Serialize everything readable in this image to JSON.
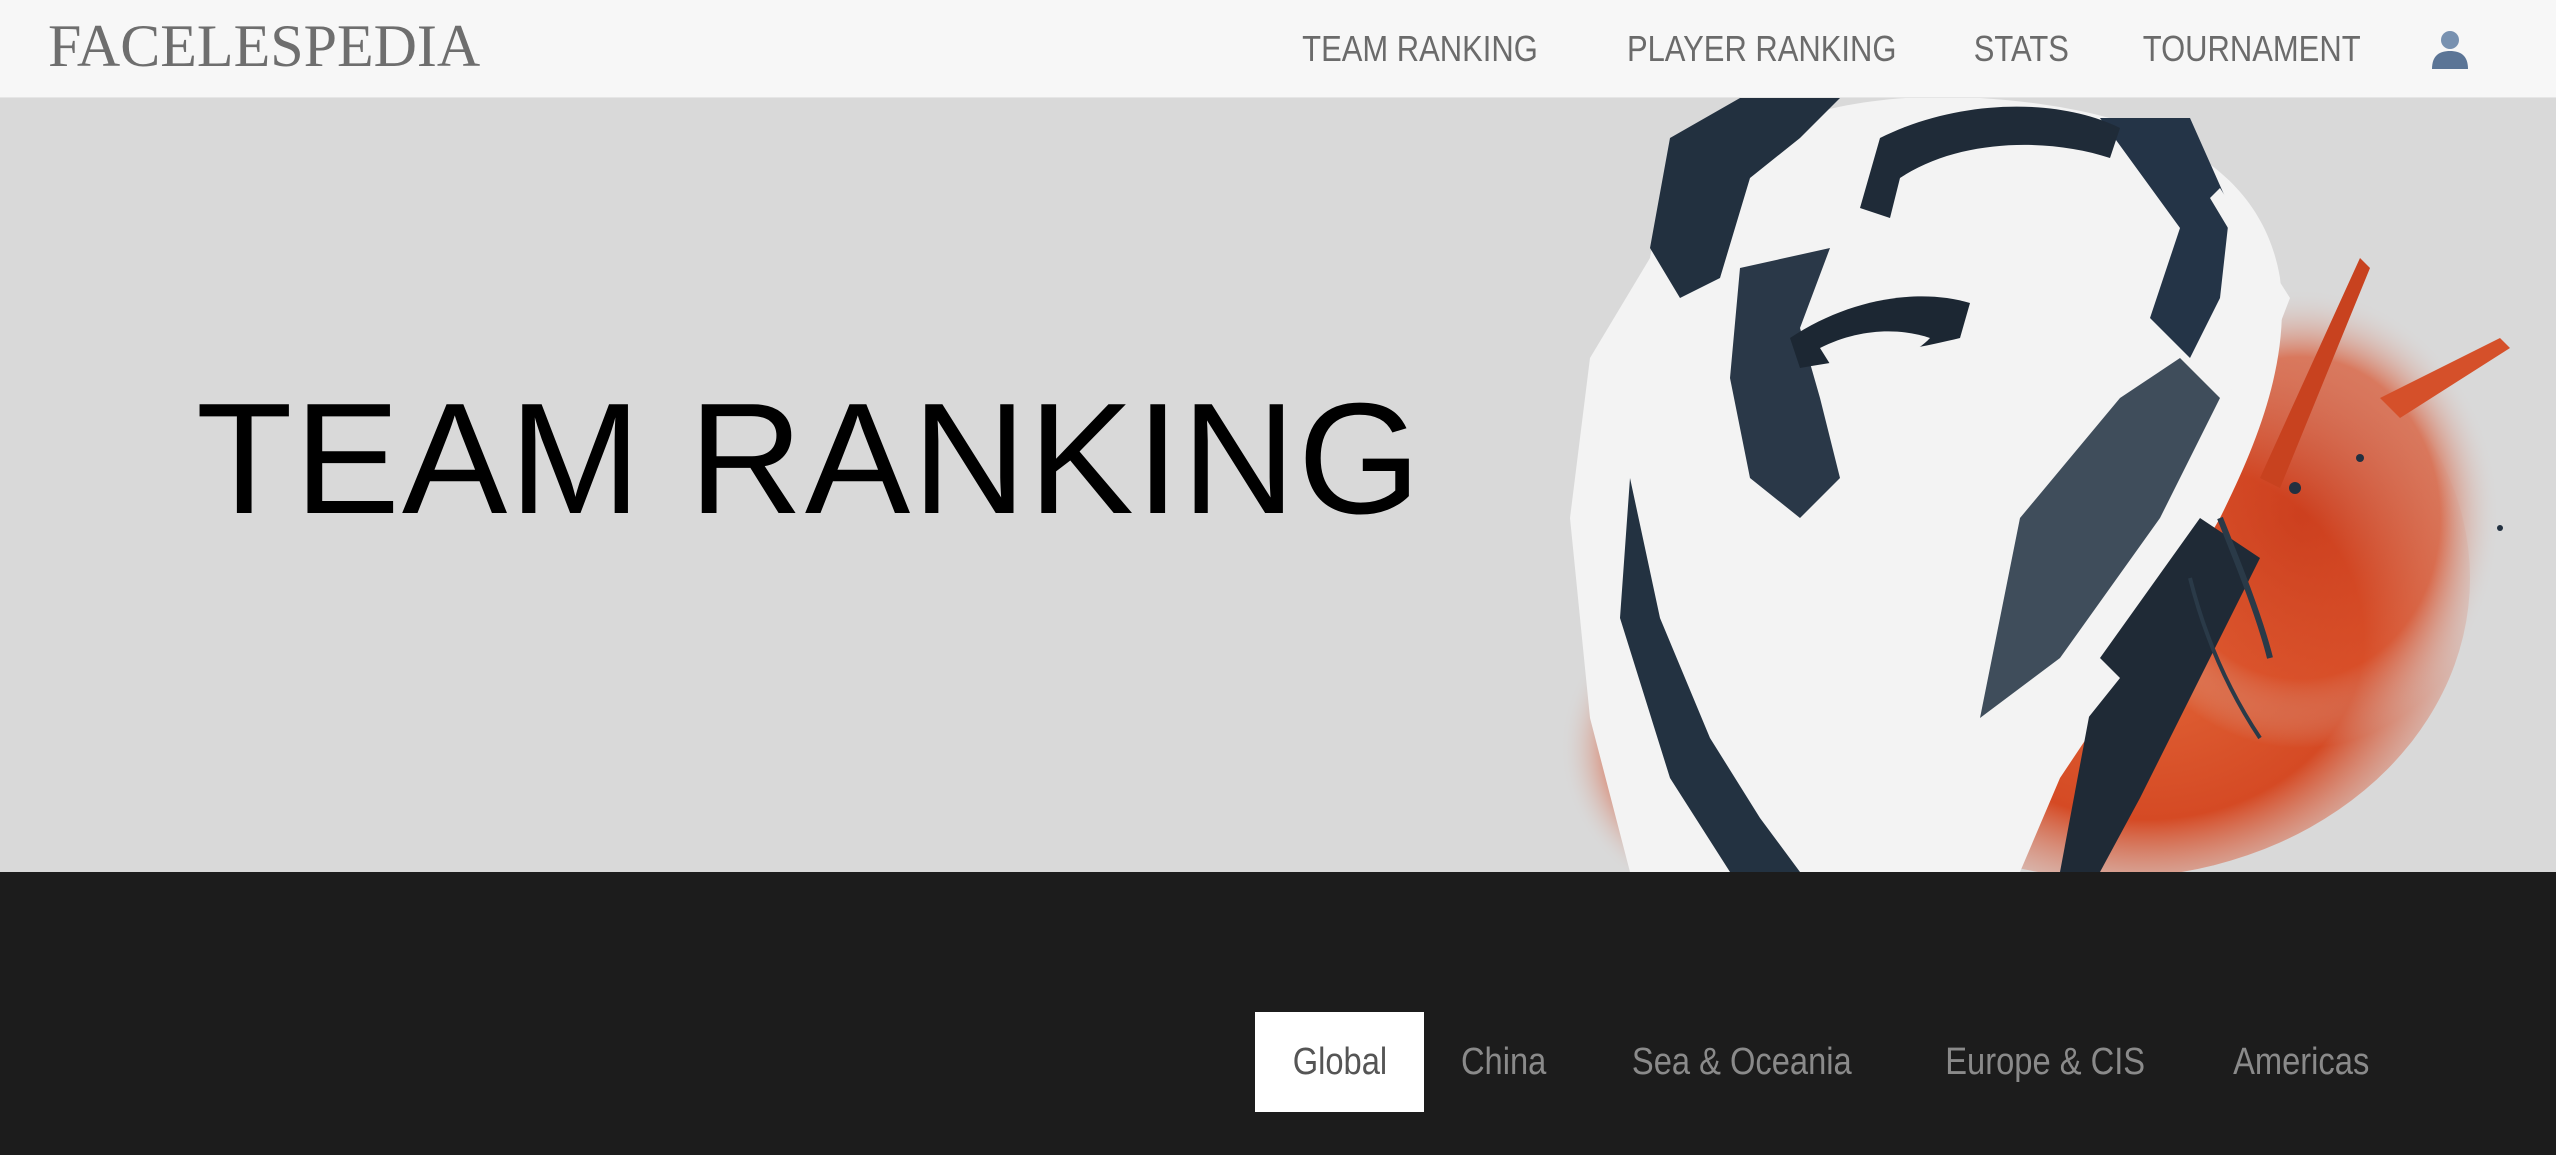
{
  "brand": {
    "logo_text": "FACELESPEDIA"
  },
  "nav": {
    "items": [
      {
        "label": "TEAM RANKING"
      },
      {
        "label": "PLAYER RANKING"
      },
      {
        "label": "STATS"
      },
      {
        "label": "TOURNAMENT"
      }
    ],
    "user_icon": "user-icon"
  },
  "hero": {
    "title": "TEAM RANKING",
    "art_icon": "hero-character-illustration"
  },
  "regions": {
    "selected": "Global",
    "tabs": [
      {
        "label": "Global"
      },
      {
        "label": "China"
      },
      {
        "label": "Sea & Oceania"
      },
      {
        "label": "Europe & CIS"
      },
      {
        "label": "Americas"
      }
    ]
  },
  "colors": {
    "nav_bg": "#f7f7f7",
    "hero_bg": "#d9d9d9",
    "band_bg": "#1c1c1c",
    "accent_orange": "#d9532b",
    "art_navy": "#243447"
  }
}
